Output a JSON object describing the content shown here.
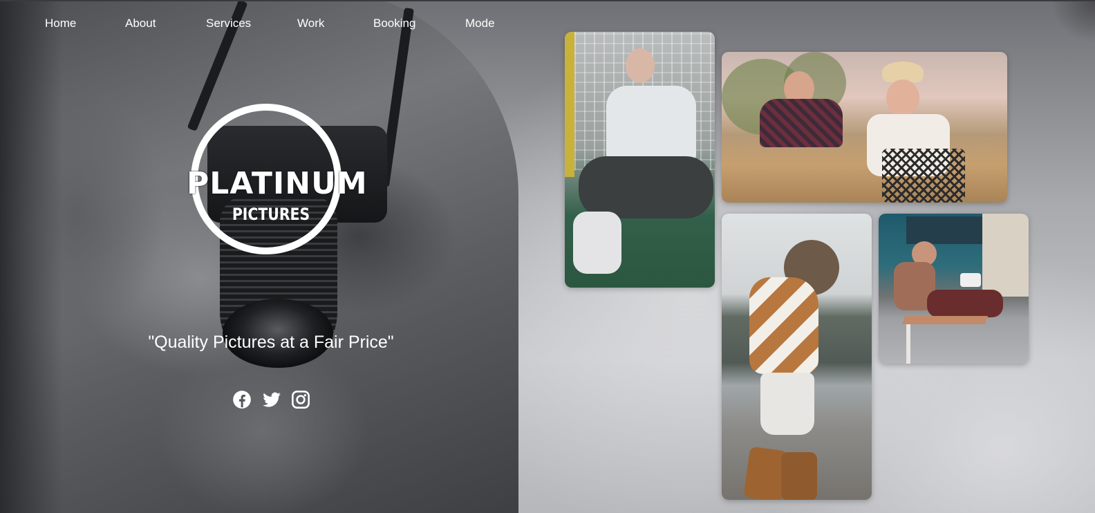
{
  "nav": {
    "items": [
      "Home",
      "About",
      "Services",
      "Work",
      "Booking",
      "Mode"
    ]
  },
  "logo": {
    "word": "PLATINUM",
    "sub": "PICTURES"
  },
  "hero": {
    "tagline": "\"Quality Pictures at a Fair Price\""
  },
  "social": {
    "icons": [
      "facebook-icon",
      "twitter-icon",
      "instagram-icon"
    ]
  },
  "gallery": {
    "photos": [
      "woman-sitting-photo",
      "couple-biking-photo",
      "woman-sweater-photo",
      "man-bench-photo"
    ]
  },
  "colors": {
    "text": "#ffffff",
    "background": "#a9aaae"
  }
}
